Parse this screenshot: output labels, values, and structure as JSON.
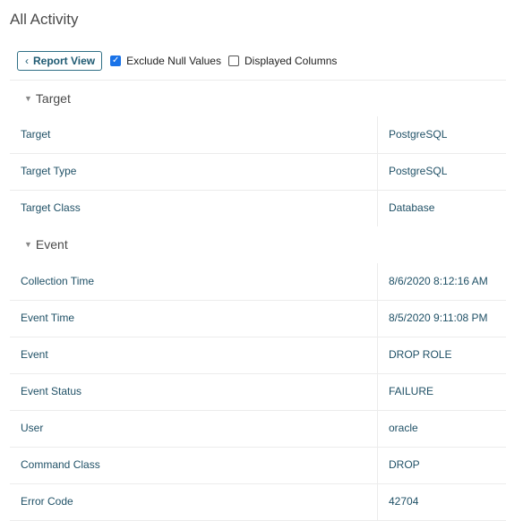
{
  "title": "All Activity",
  "toolbar": {
    "report_view_label": "Report View",
    "exclude_null": {
      "label": "Exclude Null Values",
      "checked": true
    },
    "displayed_columns": {
      "label": "Displayed Columns",
      "checked": false
    }
  },
  "sections": [
    {
      "title": "Target",
      "rows": [
        {
          "key": "Target",
          "value": "PostgreSQL"
        },
        {
          "key": "Target Type",
          "value": "PostgreSQL"
        },
        {
          "key": "Target Class",
          "value": "Database"
        }
      ]
    },
    {
      "title": "Event",
      "rows": [
        {
          "key": "Collection Time",
          "value": "8/6/2020 8:12:16 AM"
        },
        {
          "key": "Event Time",
          "value": "8/5/2020 9:11:08 PM"
        },
        {
          "key": "Event",
          "value": "DROP ROLE"
        },
        {
          "key": "Event Status",
          "value": "FAILURE"
        },
        {
          "key": "User",
          "value": "oracle"
        },
        {
          "key": "Command Class",
          "value": "DROP"
        },
        {
          "key": "Error Code",
          "value": "42704"
        }
      ]
    }
  ],
  "icons": {
    "chevron": "chevron-left-icon",
    "section_toggle": "triangle-down-icon",
    "checkbox": "checkmark-icon"
  },
  "colors": {
    "accent": "#1a73e8",
    "link_text": "#1f5066",
    "button_border": "#2f6f85"
  }
}
